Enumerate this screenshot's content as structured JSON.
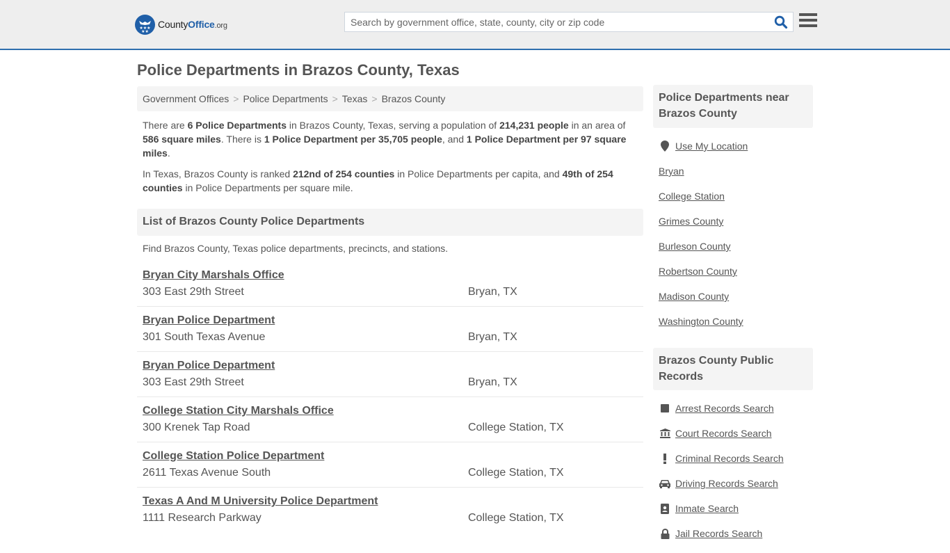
{
  "header": {
    "logo_main": "County",
    "logo_accent": "Office",
    "logo_suffix": ".org",
    "search_placeholder": "Search by government office, state, county, city or zip code",
    "search_value": "",
    "brand_color": "#1f5fa8",
    "accent_line_color": "#2f6fae"
  },
  "page": {
    "title": "Police Departments in Brazos County, Texas"
  },
  "breadcrumb": [
    {
      "label": "Government Offices"
    },
    {
      "label": "Police Departments"
    },
    {
      "label": "Texas"
    },
    {
      "label": "Brazos County"
    }
  ],
  "breadcrumb_separator": ">",
  "intro": {
    "p1": {
      "t1": "There are ",
      "b1": "6 Police Departments",
      "t2": " in Brazos County, Texas, serving a population of ",
      "b2": "214,231 people",
      "t3": " in an area of ",
      "b3": "586 square miles",
      "t4": ". There is ",
      "b4": "1 Police Department per 35,705 people",
      "t5": ", and ",
      "b5": "1 Police Department per 97 square miles",
      "t6": "."
    },
    "p2": {
      "t1": "In Texas, Brazos County is ranked ",
      "b1": "212nd of 254 counties",
      "t2": " in Police Departments per capita, and ",
      "b2": "49th of 254 counties",
      "t3": " in Police Departments per square mile."
    }
  },
  "list": {
    "heading": "List of Brazos County Police Departments",
    "description": "Find Brazos County, Texas police departments, precincts, and stations.",
    "items": [
      {
        "name": "Bryan City Marshals Office",
        "address": "303 East 29th Street",
        "city": "Bryan, TX"
      },
      {
        "name": "Bryan Police Department",
        "address": "301 South Texas Avenue",
        "city": "Bryan, TX"
      },
      {
        "name": "Bryan Police Department",
        "address": "303 East 29th Street",
        "city": "Bryan, TX"
      },
      {
        "name": "College Station City Marshals Office",
        "address": "300 Krenek Tap Road",
        "city": "College Station, TX"
      },
      {
        "name": "College Station Police Department",
        "address": "2611 Texas Avenue South",
        "city": "College Station, TX"
      },
      {
        "name": "Texas A And M University Police Department",
        "address": "1111 Research Parkway",
        "city": "College Station, TX"
      }
    ]
  },
  "sidebar": {
    "nearby": {
      "heading": "Police Departments near Brazos County",
      "location_link": {
        "label": "Use My Location",
        "icon": "map-marker-icon"
      },
      "links": [
        {
          "label": "Bryan"
        },
        {
          "label": "College Station"
        },
        {
          "label": "Grimes County"
        },
        {
          "label": "Burleson County"
        },
        {
          "label": "Robertson County"
        },
        {
          "label": "Madison County"
        },
        {
          "label": "Washington County"
        }
      ]
    },
    "records": {
      "heading": "Brazos County Public Records",
      "links": [
        {
          "label": "Arrest Records Search",
          "icon": "square-icon"
        },
        {
          "label": "Court Records Search",
          "icon": "courthouse-icon"
        },
        {
          "label": "Criminal Records Search",
          "icon": "exclamation-icon"
        },
        {
          "label": "Driving Records Search",
          "icon": "car-icon"
        },
        {
          "label": "Inmate Search",
          "icon": "id-badge-icon"
        },
        {
          "label": "Jail Records Search",
          "icon": "lock-icon"
        }
      ]
    }
  }
}
